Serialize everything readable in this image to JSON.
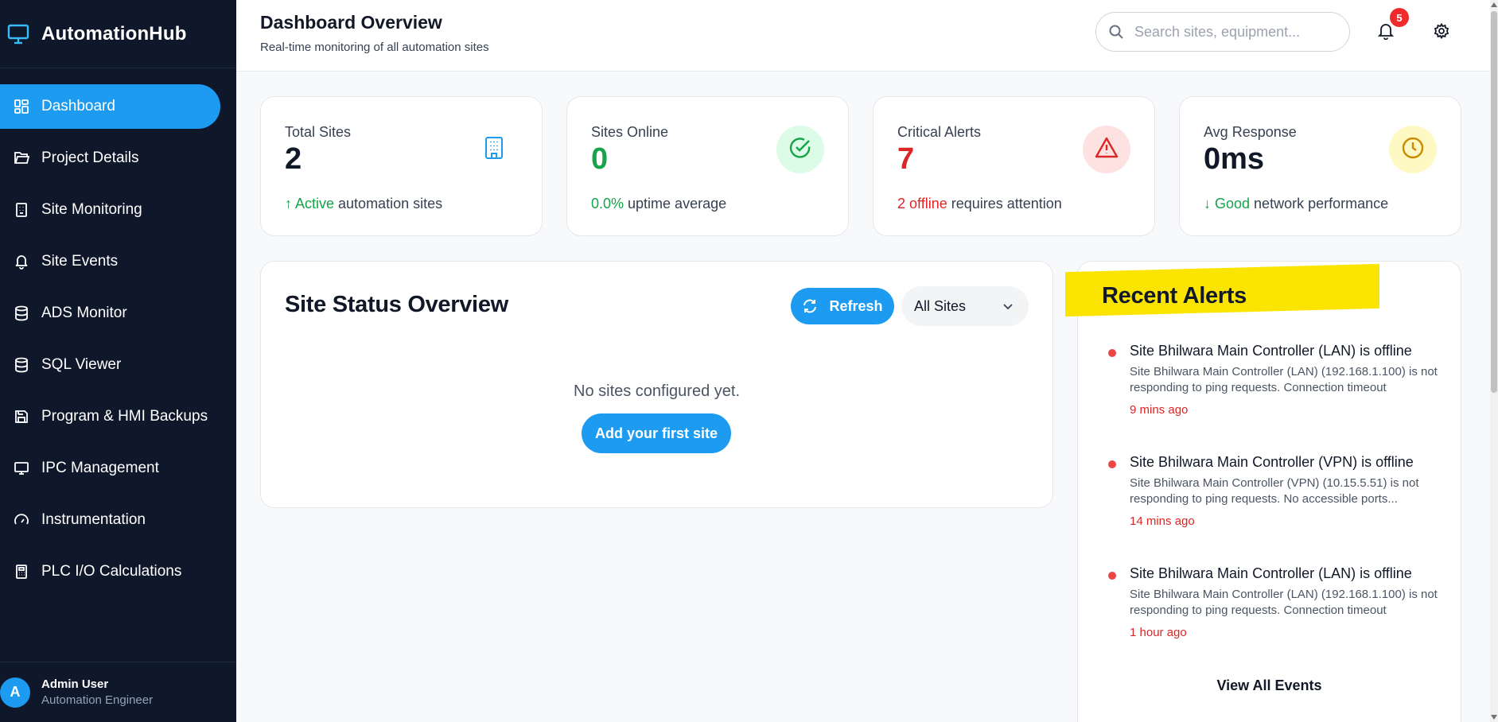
{
  "app": {
    "name": "AutomationHub"
  },
  "sidebar": {
    "items": [
      {
        "label": "Dashboard",
        "icon": "dashboard-icon",
        "active": true
      },
      {
        "label": "Project Details",
        "icon": "folder-icon"
      },
      {
        "label": "Site Monitoring",
        "icon": "building-icon"
      },
      {
        "label": "Site Events",
        "icon": "bell-icon"
      },
      {
        "label": "ADS Monitor",
        "icon": "database-icon"
      },
      {
        "label": "SQL Viewer",
        "icon": "database-icon"
      },
      {
        "label": "Program & HMI Backups",
        "icon": "save-icon"
      },
      {
        "label": "IPC Management",
        "icon": "monitor-icon"
      },
      {
        "label": "Instrumentation",
        "icon": "gauge-icon"
      },
      {
        "label": "PLC I/O Calculations",
        "icon": "calculator-icon"
      }
    ],
    "user": {
      "initial": "A",
      "name": "Admin User",
      "role": "Automation Engineer"
    }
  },
  "header": {
    "title": "Dashboard Overview",
    "subtitle": "Real-time monitoring of all automation sites",
    "search_placeholder": "Search sites, equipment...",
    "notification_count": "5"
  },
  "stats": [
    {
      "label": "Total Sites",
      "value": "2",
      "accent": "↑ Active",
      "rest": " automation sites",
      "color": "#111827",
      "accent_color": "#16a34a",
      "icon": "building-icon"
    },
    {
      "label": "Sites Online",
      "value": "0",
      "accent": "0.0%",
      "rest": " uptime average",
      "color": "#16a34a",
      "accent_color": "#16a34a",
      "icon": "check-circle-icon"
    },
    {
      "label": "Critical Alerts",
      "value": "7",
      "accent": "2 offline",
      "rest": " requires attention",
      "color": "#dc2626",
      "accent_color": "#dc2626",
      "icon": "warning-icon"
    },
    {
      "label": "Avg Response",
      "value": "0ms",
      "accent": "↓ Good",
      "rest": " network performance",
      "color": "#111827",
      "accent_color": "#16a34a",
      "icon": "clock-icon"
    }
  ],
  "site_status": {
    "title": "Site Status Overview",
    "refresh_label": "Refresh",
    "filter_value": "All Sites",
    "empty_text": "No sites configured yet.",
    "add_label": "Add your first site"
  },
  "alerts": {
    "title": "Recent Alerts",
    "items": [
      {
        "title": "Site Bhilwara Main Controller (LAN) is offline",
        "desc": "Site Bhilwara Main Controller (LAN) (192.168.1.100) is not responding to ping requests. Connection timeout",
        "time": "9 mins ago"
      },
      {
        "title": "Site Bhilwara Main Controller (VPN) is offline",
        "desc": "Site Bhilwara Main Controller (VPN) (10.15.5.51) is not responding to ping requests. No accessible ports...",
        "time": "14 mins ago"
      },
      {
        "title": "Site Bhilwara Main Controller (LAN) is offline",
        "desc": "Site Bhilwara Main Controller (LAN) (192.168.1.100) is not responding to ping requests. Connection timeout",
        "time": "1 hour ago"
      }
    ],
    "view_all_label": "View All Events"
  },
  "colors": {
    "sidebar_bg": "#0f172a",
    "accent": "#1d9bf0",
    "danger": "#dc2626",
    "success": "#16a34a"
  }
}
